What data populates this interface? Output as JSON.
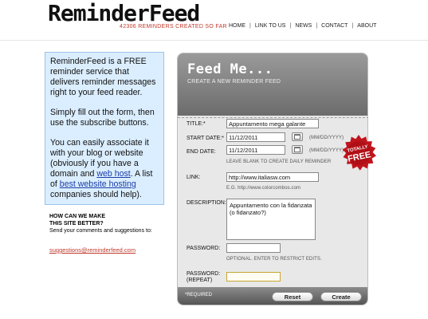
{
  "header": {
    "logo": "ReminderFeed",
    "tagline": "42306 REMINDERS CREATED SO FAR",
    "nav": [
      "HOME",
      "LINK TO US",
      "NEWS",
      "CONTACT",
      "ABOUT"
    ]
  },
  "info": {
    "p1": "ReminderFeed is a FREE reminder service that delivers reminder messages right to your feed reader.",
    "p2": "Simply fill out the form, then use the subscribe buttons.",
    "p3_a": "You can easily associate it with your blog or website (obviously if you have a domain and",
    "p3_link1": "web host",
    "p3_b": ". A list of",
    "p3_link2": "best website hosting",
    "p3_c": "companies should help)."
  },
  "improve": {
    "heading1": "HOW CAN WE MAKE",
    "heading2": "THIS SITE BETTER?",
    "text": "Send your comments and suggestions to:",
    "email": "suggestions@reminderfeed.com"
  },
  "form": {
    "title": "Feed Me...",
    "subtitle": "CREATE A NEW REMINDER FEED",
    "title_label": "TITLE:*",
    "title_value": "Appuntamento mega galante",
    "start_label": "START DATE:*",
    "start_value": "11/12/2011",
    "end_label": "END DATE:",
    "end_value": "11/12/2011",
    "date_format": "(MM/DD/YYYY)",
    "end_hint": "LEAVE BLANK TO CREATE DAILY REMINDER",
    "link_label": "LINK:",
    "link_value": "http://www.italiasw.com",
    "link_hint": "E.G. http://www.colorcombos.com",
    "desc_label": "DESCRIPTION:*",
    "desc_value": "Appuntamento con la fidanzata (o fidanzato?)",
    "password_label": "PASSWORD:",
    "password_hint": "OPTIONAL. ENTER TO RESTRICT EDITS.",
    "password_repeat_label_1": "PASSWORD:",
    "password_repeat_label_2": "(REPEAT)",
    "required_note": "*REQUIRED",
    "reset_label": "Reset",
    "create_label": "Create"
  },
  "seal": {
    "line1": "TOTALLY",
    "line2": "FREE"
  },
  "colors": {
    "accent_red": "#c0392b",
    "info_bg": "#dbeeff",
    "panel_head": "#7c7c7c"
  }
}
